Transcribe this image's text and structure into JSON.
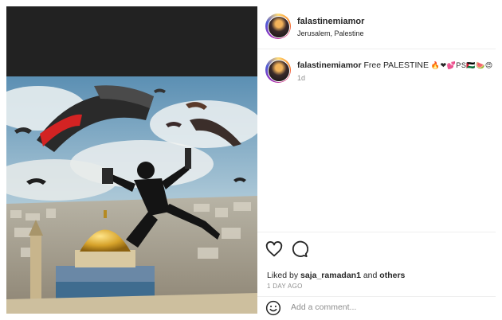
{
  "post": {
    "username": "falastinemiamor",
    "location": "Jerusalem, Palestine"
  },
  "caption": {
    "username": "falastinemiamor",
    "text": "Free PALESTINE",
    "emojis": "🔥❤💕PS🇵🇸🍉😍",
    "time": "1d"
  },
  "actions": {
    "like_icon": "heart-icon",
    "comment_icon": "speech-bubble-icon"
  },
  "likes": {
    "prefix": "Liked by",
    "user": "saja_ramadan1",
    "connector": "and",
    "others": "others"
  },
  "date": "1 DAY AGO",
  "add_comment": {
    "icon": "smile-icon",
    "placeholder": "Add a comment..."
  }
}
